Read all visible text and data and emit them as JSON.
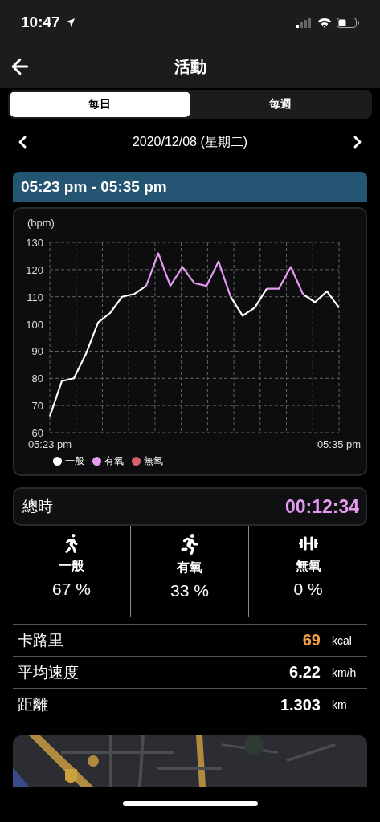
{
  "status_bar": {
    "time": "10:47"
  },
  "header": {
    "title": "活動"
  },
  "tabs": [
    {
      "label": "每日",
      "selected": true
    },
    {
      "label": "每週",
      "selected": false
    }
  ],
  "date_nav": {
    "date": "2020/12/08 (星期二)"
  },
  "session": {
    "time_range": "05:23 pm - 05:35 pm"
  },
  "heart_rate": {
    "chart_data": {
      "type": "line",
      "ylabel": "(bpm)",
      "categories": [
        "05:23 pm",
        null,
        null,
        null,
        null,
        null,
        null,
        null,
        null,
        null,
        null,
        null,
        null,
        null,
        null,
        null,
        null,
        null,
        null,
        null,
        null,
        null,
        null,
        null,
        "05:35 pm"
      ],
      "yticks": [
        60,
        70,
        80,
        90,
        100,
        110,
        120,
        130
      ],
      "ylim": [
        60,
        130
      ],
      "grid": true,
      "series": [
        {
          "name": "一般",
          "color": "#ffffff",
          "values": [
            66,
            79,
            80,
            89,
            100.5,
            104,
            110,
            111,
            114,
            null,
            null,
            null,
            null,
            null,
            null,
            110,
            103,
            106,
            113,
            null,
            null,
            111,
            108,
            112,
            106
          ]
        },
        {
          "name": "有氧",
          "color": "#e49bf0",
          "values": [
            null,
            null,
            null,
            null,
            null,
            null,
            null,
            null,
            114,
            126,
            114,
            121,
            115,
            114,
            123,
            110,
            null,
            null,
            113,
            113,
            121,
            111,
            null,
            null,
            null
          ]
        },
        {
          "name": "無氧",
          "color": "#d9606a",
          "values": [
            null,
            null,
            null,
            null,
            null,
            null,
            null,
            null,
            null,
            null,
            null,
            null,
            null,
            null,
            null,
            null,
            null,
            null,
            null,
            null,
            null,
            null,
            null,
            null,
            null
          ]
        }
      ]
    }
  },
  "total": {
    "label": "總時",
    "value": "00:12:34"
  },
  "zones": [
    {
      "kind": "walk",
      "label": "一般",
      "percent": "67 %"
    },
    {
      "kind": "run",
      "label": "有氧",
      "percent": "33 %"
    },
    {
      "kind": "lift",
      "label": "無氧",
      "percent": "0 %"
    }
  ],
  "stats": [
    {
      "label": "卡路里",
      "value": "69",
      "unit": "kcal",
      "color": "#f5a142"
    },
    {
      "label": "平均速度",
      "value": "6.22",
      "unit": "km/h",
      "color": "#ffffff"
    },
    {
      "label": "距離",
      "value": "1.303",
      "unit": "km",
      "color": "#ffffff"
    }
  ]
}
